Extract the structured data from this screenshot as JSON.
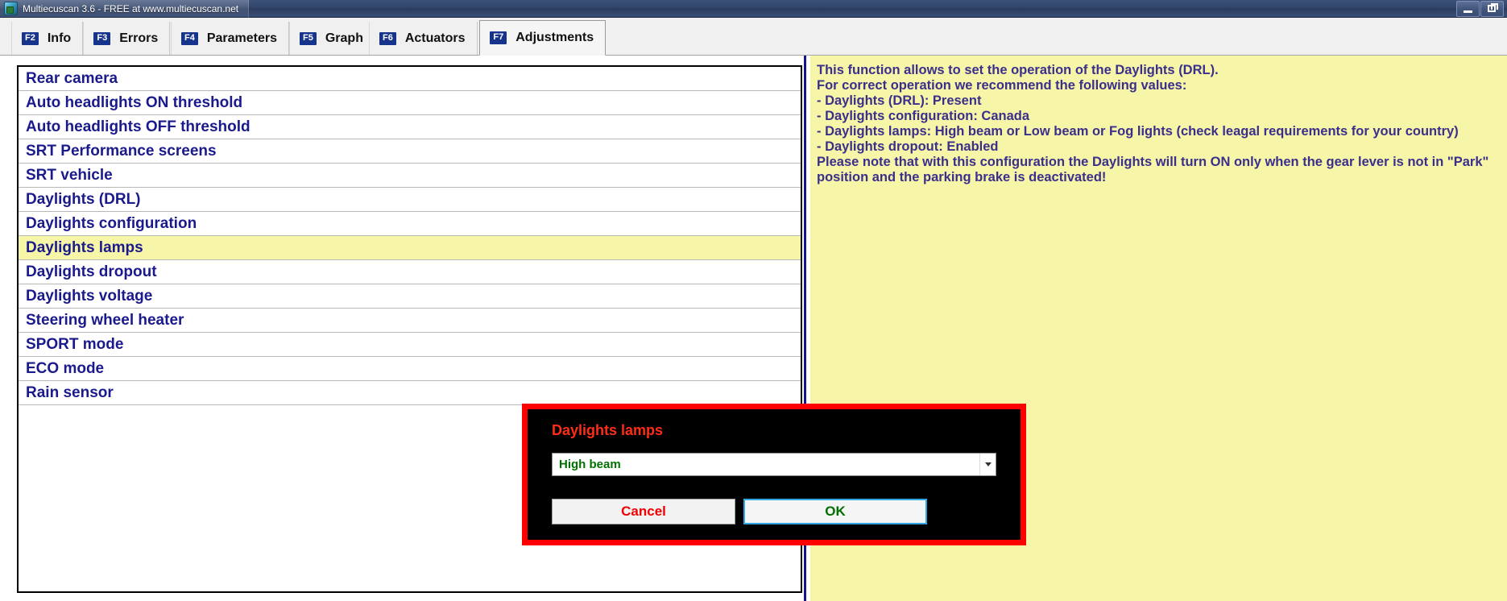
{
  "window": {
    "title": "Multiecuscan 3.6 - FREE at www.multiecuscan.net",
    "app_icon": "multiecuscan-logo-icon",
    "minimize_label": "minimize-icon",
    "restore_label": "restore-icon"
  },
  "tabs": [
    {
      "fkey": "F2",
      "label": "Info",
      "active": false
    },
    {
      "fkey": "F3",
      "label": "Errors",
      "active": false
    },
    {
      "fkey": "F4",
      "label": "Parameters",
      "active": false
    },
    {
      "fkey": "F5",
      "label": "Graph",
      "active": false
    },
    {
      "fkey": "F6",
      "label": "Actuators",
      "active": false
    },
    {
      "fkey": "F7",
      "label": "Adjustments",
      "active": true
    }
  ],
  "adjustments_list": [
    {
      "label": "Rear camera",
      "selected": false
    },
    {
      "label": "Auto headlights ON threshold",
      "selected": false
    },
    {
      "label": "Auto headlights OFF threshold",
      "selected": false
    },
    {
      "label": "SRT Performance screens",
      "selected": false
    },
    {
      "label": "SRT vehicle",
      "selected": false
    },
    {
      "label": "Daylights (DRL)",
      "selected": false
    },
    {
      "label": "Daylights configuration",
      "selected": false
    },
    {
      "label": "Daylights lamps",
      "selected": true
    },
    {
      "label": "Daylights dropout",
      "selected": false
    },
    {
      "label": "Daylights voltage",
      "selected": false
    },
    {
      "label": "Steering wheel heater",
      "selected": false
    },
    {
      "label": "SPORT mode",
      "selected": false
    },
    {
      "label": "ECO mode",
      "selected": false
    },
    {
      "label": "Rain sensor",
      "selected": false
    }
  ],
  "help": {
    "lines": [
      "This function allows to set the operation of the Daylights (DRL).",
      "For correct operation we recommend the following values:",
      "- Daylights (DRL): Present",
      "- Daylights configuration: Canada",
      "- Daylights lamps: High beam or Low beam or Fog lights (check leagal requirements for your country)",
      "- Daylights dropout: Enabled",
      "Please note that with this configuration the Daylights will turn ON only when the gear lever is not in \"Park\"",
      "position and the parking brake is deactivated!"
    ]
  },
  "dialog": {
    "title": "Daylights lamps",
    "selected_value": "High beam",
    "dropdown_icon": "chevron-down-icon",
    "cancel_label": "Cancel",
    "ok_label": "OK"
  },
  "colors": {
    "accent_blue": "#17348c",
    "list_text": "#1a1a8c",
    "selected_row": "#f7f5a8",
    "help_background": "#f7f5a8",
    "help_text": "#3b2f8c",
    "dialog_border": "#ff0000",
    "dialog_background": "#000000",
    "dialog_title": "#ff2d18",
    "ok_text": "#007000",
    "cancel_text": "#f00000"
  }
}
